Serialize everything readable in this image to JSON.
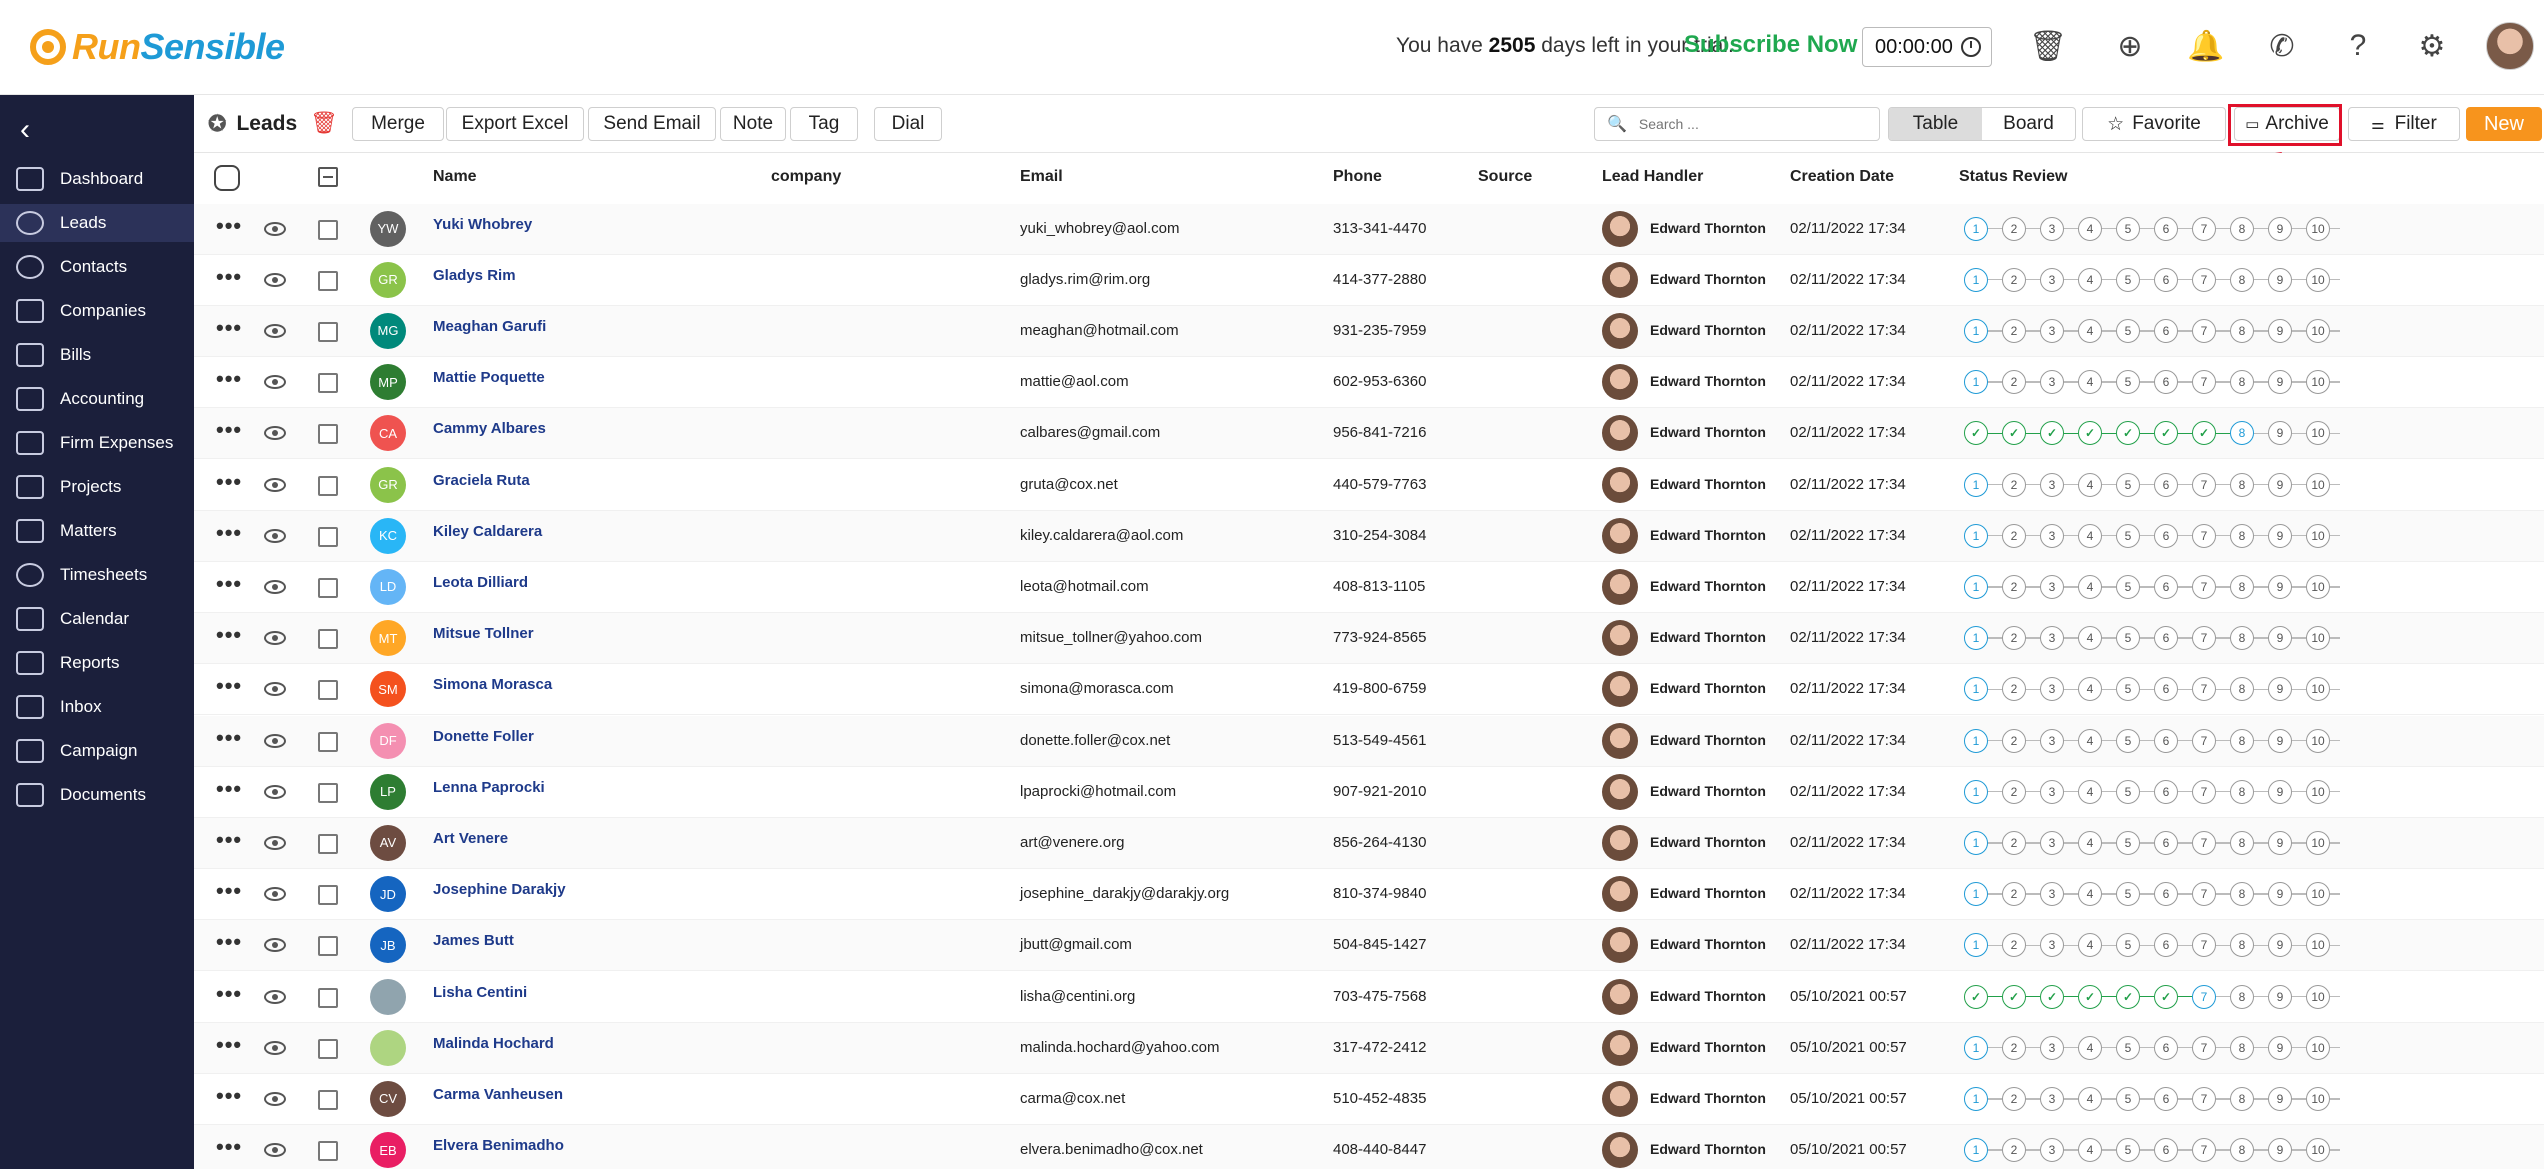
{
  "app": {
    "logo_part1": "Run",
    "logo_part2": "Sensible",
    "trial_prefix": "You have",
    "trial_days": "2505",
    "trial_suffix": "days left in your trial.",
    "subscribe": "Subscribe Now",
    "timer": "00:00:00"
  },
  "sidebar": {
    "items": [
      {
        "label": "Dashboard"
      },
      {
        "label": "Leads"
      },
      {
        "label": "Contacts"
      },
      {
        "label": "Companies"
      },
      {
        "label": "Bills"
      },
      {
        "label": "Accounting"
      },
      {
        "label": "Firm Expenses"
      },
      {
        "label": "Projects"
      },
      {
        "label": "Matters"
      },
      {
        "label": "Timesheets"
      },
      {
        "label": "Calendar"
      },
      {
        "label": "Reports"
      },
      {
        "label": "Inbox"
      },
      {
        "label": "Campaign"
      },
      {
        "label": "Documents"
      }
    ]
  },
  "toolbar": {
    "title": "Leads",
    "merge": "Merge",
    "export": "Export Excel",
    "send_email": "Send Email",
    "note": "Note",
    "tag": "Tag",
    "dial": "Dial",
    "search_placeholder": "Search ...",
    "view_table": "Table",
    "view_board": "Board",
    "favorite": "Favorite",
    "archive": "Archive",
    "filter": "Filter",
    "new": "New"
  },
  "columns": {
    "name": "Name",
    "company": "company",
    "email": "Email",
    "phone": "Phone",
    "source": "Source",
    "handler": "Lead Handler",
    "created": "Creation Date",
    "status": "Status Review"
  },
  "status_steps": [
    "1",
    "2",
    "3",
    "4",
    "5",
    "6",
    "7",
    "8",
    "9",
    "10"
  ],
  "rows": [
    {
      "initials": "YW",
      "color": "#616161",
      "name": "Yuki Whobrey",
      "email": "yuki_whobrey@aol.com",
      "phone": "313-341-4470",
      "handler": "Edward Thornton",
      "created": "02/11/2022 17:34",
      "completed": 0
    },
    {
      "initials": "GR",
      "color": "#8bc34a",
      "name": "Gladys Rim",
      "email": "gladys.rim@rim.org",
      "phone": "414-377-2880",
      "handler": "Edward Thornton",
      "created": "02/11/2022 17:34",
      "completed": 0
    },
    {
      "initials": "MG",
      "color": "#00897b",
      "name": "Meaghan Garufi",
      "email": "meaghan@hotmail.com",
      "phone": "931-235-7959",
      "handler": "Edward Thornton",
      "created": "02/11/2022 17:34",
      "completed": 0
    },
    {
      "initials": "MP",
      "color": "#2e7d32",
      "name": "Mattie Poquette",
      "email": "mattie@aol.com",
      "phone": "602-953-6360",
      "handler": "Edward Thornton",
      "created": "02/11/2022 17:34",
      "completed": 0
    },
    {
      "initials": "CA",
      "color": "#ef5350",
      "name": "Cammy Albares",
      "email": "calbares@gmail.com",
      "phone": "956-841-7216",
      "handler": "Edward Thornton",
      "created": "02/11/2022 17:34",
      "completed": 7
    },
    {
      "initials": "GR",
      "color": "#8bc34a",
      "name": "Graciela Ruta",
      "email": "gruta@cox.net",
      "phone": "440-579-7763",
      "handler": "Edward Thornton",
      "created": "02/11/2022 17:34",
      "completed": 0
    },
    {
      "initials": "KC",
      "color": "#29b6f6",
      "name": "Kiley Caldarera",
      "email": "kiley.caldarera@aol.com",
      "phone": "310-254-3084",
      "handler": "Edward Thornton",
      "created": "02/11/2022 17:34",
      "completed": 0
    },
    {
      "initials": "LD",
      "color": "#64b5f6",
      "name": "Leota Dilliard",
      "email": "leota@hotmail.com",
      "phone": "408-813-1105",
      "handler": "Edward Thornton",
      "created": "02/11/2022 17:34",
      "completed": 0
    },
    {
      "initials": "MT",
      "color": "#ffa726",
      "name": "Mitsue Tollner",
      "email": "mitsue_tollner@yahoo.com",
      "phone": "773-924-8565",
      "handler": "Edward Thornton",
      "created": "02/11/2022 17:34",
      "completed": 0
    },
    {
      "initials": "SM",
      "color": "#f4511e",
      "name": "Simona Morasca",
      "email": "simona@morasca.com",
      "phone": "419-800-6759",
      "handler": "Edward Thornton",
      "created": "02/11/2022 17:34",
      "completed": 0
    },
    {
      "initials": "DF",
      "color": "#f48fb1",
      "name": "Donette Foller",
      "email": "donette.foller@cox.net",
      "phone": "513-549-4561",
      "handler": "Edward Thornton",
      "created": "02/11/2022 17:34",
      "completed": 0
    },
    {
      "initials": "LP",
      "color": "#2e7d32",
      "name": "Lenna Paprocki",
      "email": "lpaprocki@hotmail.com",
      "phone": "907-921-2010",
      "handler": "Edward Thornton",
      "created": "02/11/2022 17:34",
      "completed": 0
    },
    {
      "initials": "AV",
      "color": "#6d4c41",
      "name": "Art Venere",
      "email": "art@venere.org",
      "phone": "856-264-4130",
      "handler": "Edward Thornton",
      "created": "02/11/2022 17:34",
      "completed": 0
    },
    {
      "initials": "JD",
      "color": "#1565c0",
      "name": "Josephine Darakjy",
      "email": "josephine_darakjy@darakjy.org",
      "phone": "810-374-9840",
      "handler": "Edward Thornton",
      "created": "02/11/2022 17:34",
      "completed": 0
    },
    {
      "initials": "JB",
      "color": "#1565c0",
      "name": "James Butt",
      "email": "jbutt@gmail.com",
      "phone": "504-845-1427",
      "handler": "Edward Thornton",
      "created": "02/11/2022 17:34",
      "completed": 0
    },
    {
      "initials": "",
      "color": "#90a4ae",
      "name": "Lisha Centini",
      "email": "lisha@centini.org",
      "phone": "703-475-7568",
      "handler": "Edward Thornton",
      "created": "05/10/2021 00:57",
      "completed": 6
    },
    {
      "initials": "",
      "color": "#aed581",
      "name": "Malinda Hochard",
      "email": "malinda.hochard@yahoo.com",
      "phone": "317-472-2412",
      "handler": "Edward Thornton",
      "created": "05/10/2021 00:57",
      "completed": 0
    },
    {
      "initials": "CV",
      "color": "#6d4c41",
      "name": "Carma Vanheusen",
      "email": "carma@cox.net",
      "phone": "510-452-4835",
      "handler": "Edward Thornton",
      "created": "05/10/2021 00:57",
      "completed": 0
    },
    {
      "initials": "EB",
      "color": "#e91e63",
      "name": "Elvera Benimadho",
      "email": "elvera.benimadho@cox.net",
      "phone": "408-440-8447",
      "handler": "Edward Thornton",
      "created": "05/10/2021 00:57",
      "completed": 0
    }
  ]
}
